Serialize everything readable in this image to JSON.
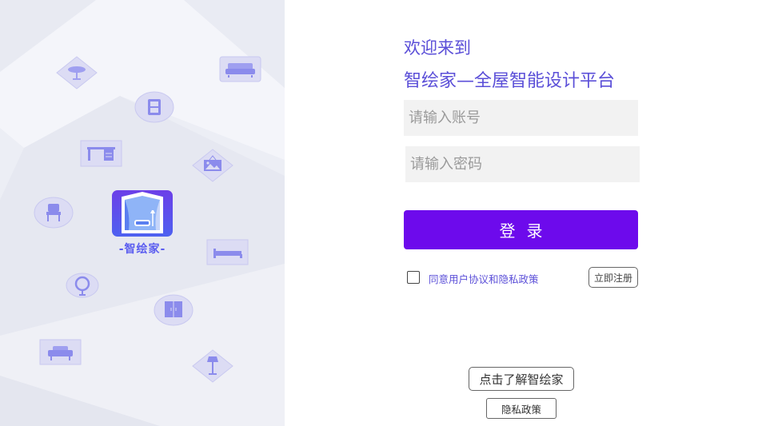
{
  "brand": {
    "logo_text": "-智绘家-",
    "accent_color": "#6d0aec",
    "title_color": "#5b4fd8"
  },
  "heading": {
    "welcome": "欢迎来到",
    "platform": "智绘家—全屋智能设计平台"
  },
  "form": {
    "account_placeholder": "请输入账号",
    "password_placeholder": "请输入密码",
    "login_label": "登录",
    "agree_label": "同意用户协议和隐私政策",
    "agree_checked": false,
    "register_label": "立即注册"
  },
  "footer": {
    "learn_more_label": "点击了解智绘家",
    "privacy_label": "隐私政策"
  },
  "decor_icons": [
    "round-table-icon",
    "sofa-icon",
    "cabinet-icon",
    "desk-icon",
    "picture-frame-icon",
    "chair-icon",
    "bed-icon",
    "mirror-icon",
    "wardrobe-icon",
    "armchair-icon",
    "floor-lamp-icon"
  ]
}
